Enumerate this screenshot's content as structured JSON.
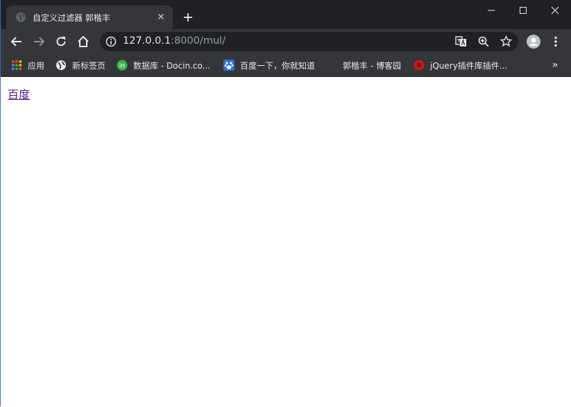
{
  "tab": {
    "title": "自定义过滤器 郭楷丰",
    "close_label": "✕"
  },
  "new_tab_label": "+",
  "address_bar": {
    "host": "127.0.0.1",
    "port_path": ":8000/mul/"
  },
  "bookmarks": {
    "items": [
      {
        "label": "应用",
        "icon": "apps-grid-icon"
      },
      {
        "label": "新标签页",
        "icon": "globe-icon"
      },
      {
        "label": "数据库 - Docin.co...",
        "icon": "docin-icon"
      },
      {
        "label": "百度一下，你就知道",
        "icon": "baidu-paw-icon"
      },
      {
        "label": "郭楷丰 - 博客园",
        "icon": "cnblogs-icon"
      },
      {
        "label": "jQuery插件库插件...",
        "icon": "jquery-icon"
      }
    ],
    "more_label": "»"
  },
  "page": {
    "link_text": "百度"
  },
  "colors": {
    "tab_strip": "#202124",
    "toolbar": "#35363a",
    "link_visited": "#551a8b"
  }
}
